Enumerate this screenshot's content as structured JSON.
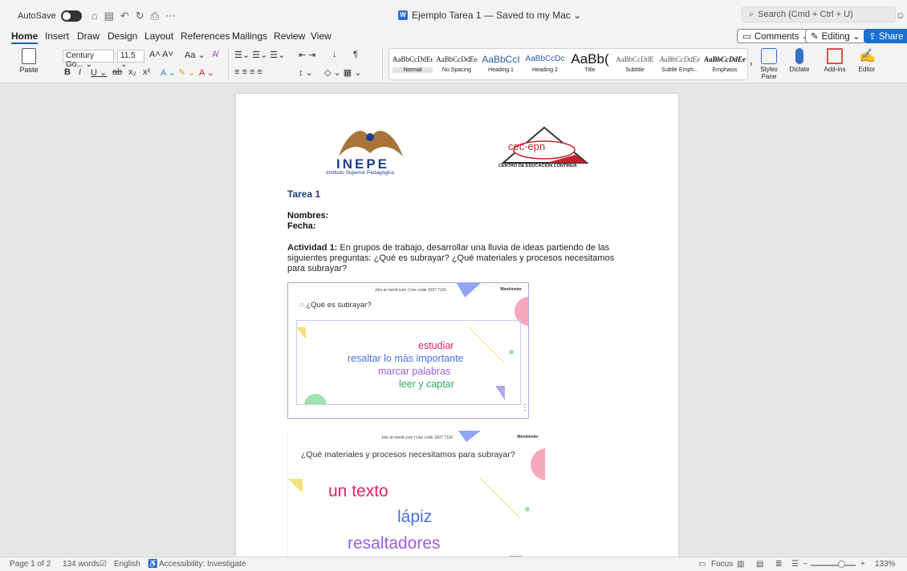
{
  "titlebar": {
    "autosave_label": "AutoSave",
    "doc_title": "Ejemplo Tarea 1 — Saved to my Mac ⌄",
    "search_placeholder": "Search (Cmd + Ctrl + U)"
  },
  "menu": {
    "tabs": [
      "Home",
      "Insert",
      "Draw",
      "Design",
      "Layout",
      "References",
      "Mailings",
      "Review",
      "View"
    ],
    "comments_label": "Comments ⌄",
    "editing_label": "Editing ⌄",
    "share_label": "Share ⌄"
  },
  "ribbon": {
    "paste_label": "Paste",
    "font_name": "Century Go... ⌄",
    "font_size": "11,5 ⌄",
    "styles": [
      {
        "sample": "AaBbCcDdEe",
        "name": "Normal"
      },
      {
        "sample": "AaBbCcDdEe",
        "name": "No Spacing"
      },
      {
        "sample": "AaBbCcI",
        "name": "Heading 1"
      },
      {
        "sample": "AaBbCcDc",
        "name": "Heading 2"
      },
      {
        "sample": "AaBb(",
        "name": "Title"
      },
      {
        "sample": "AaBbCcDdE",
        "name": "Subtitle"
      },
      {
        "sample": "AaBbCcDdEe",
        "name": "Subtle Emph..."
      },
      {
        "sample": "AaBbCcDdEe",
        "name": "Emphasis"
      }
    ],
    "styles_pane_label": "Styles Pane",
    "dictate_label": "Dictate",
    "addins_label": "Add-ins",
    "editor_label": "Editor"
  },
  "document": {
    "logo_left_name": "INEPE",
    "logo_left_sub": "Instituto Superior Pedagógico",
    "logo_right_name": "cec·epn",
    "logo_right_sub": "CENTRO DE EDUCACIÓN CONTINUA",
    "heading": "Tarea 1",
    "nombres_label": "Nombres:",
    "fecha_label": "Fecha:",
    "activity_label": "Actividad 1:",
    "activity_text": " En grupos de trabajo, desarrollar una lluvia de ideas partiendo de las siguientes preguntas: ¿Qué es subrayar? ¿Qué materiales y procesos necesitamos para subrayar?",
    "slide1": {
      "join": "Join at menti.com | Use code 1607 7116",
      "brand": "Mentimeter",
      "question": "¿Qué es subrayar?",
      "words": [
        {
          "text": "estudiar",
          "color": "#e0245e"
        },
        {
          "text": "resaltar lo más importante",
          "color": "#4a6fe0"
        },
        {
          "text": "marcar palabras",
          "color": "#9d5ce0"
        },
        {
          "text": "leer y captar",
          "color": "#2ea860"
        }
      ]
    },
    "slide2": {
      "join": "Join at menti.com | Use code 1607 7116",
      "brand": "Mentimeter",
      "question": "¿Qué materiales y procesos necesitamos para subrayar?",
      "words": [
        {
          "text": "un texto",
          "color": "#e0245e"
        },
        {
          "text": "lápiz",
          "color": "#4a6fe0"
        },
        {
          "text": "resaltadores",
          "color": "#9d5ce0"
        }
      ]
    }
  },
  "statusbar": {
    "page": "Page 1 of 2",
    "words": "134 words",
    "language": "English",
    "accessibility": "Accessibility: Investigate",
    "focus": "Focus",
    "zoom": "133%"
  }
}
